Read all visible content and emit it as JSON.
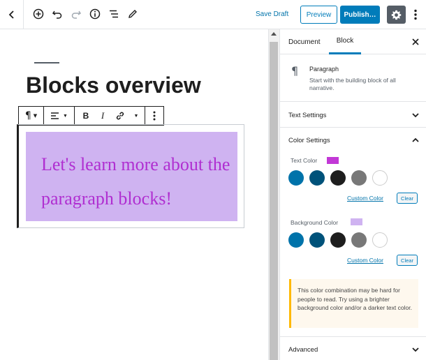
{
  "topbar": {
    "save_draft": "Save Draft",
    "preview": "Preview",
    "publish": "Publish…"
  },
  "editor": {
    "title": "Blocks overview",
    "paragraph_text": "Let's learn more about the paragraph blocks!",
    "paragraph_text_color": "#b02fd1",
    "paragraph_background_color": "#cfb3f1"
  },
  "sidebar": {
    "tabs": [
      {
        "label": "Document",
        "active": false
      },
      {
        "label": "Block",
        "active": true
      }
    ],
    "block": {
      "name": "Paragraph",
      "description": "Start with the building block of all narrative."
    },
    "panels": {
      "text_settings": "Text Settings",
      "color_settings": "Color Settings",
      "advanced": "Advanced"
    },
    "text_color": {
      "label": "Text Color",
      "value": "#c238d6"
    },
    "background_color": {
      "label": "Background Color",
      "value": "#cfb3f1"
    },
    "palette": [
      "#0073aa",
      "#00527a",
      "#1e1e1e",
      "#787878",
      "#ffffff"
    ],
    "custom_color_label": "Custom Color",
    "clear_label": "Clear",
    "contrast_notice": "This color combination may be hard for people to read. Try using a brighter background color and/or a darker text color."
  },
  "colors": {
    "accent": "#007cba",
    "notice_border": "#ffb900",
    "settings_button": "#555d66"
  }
}
